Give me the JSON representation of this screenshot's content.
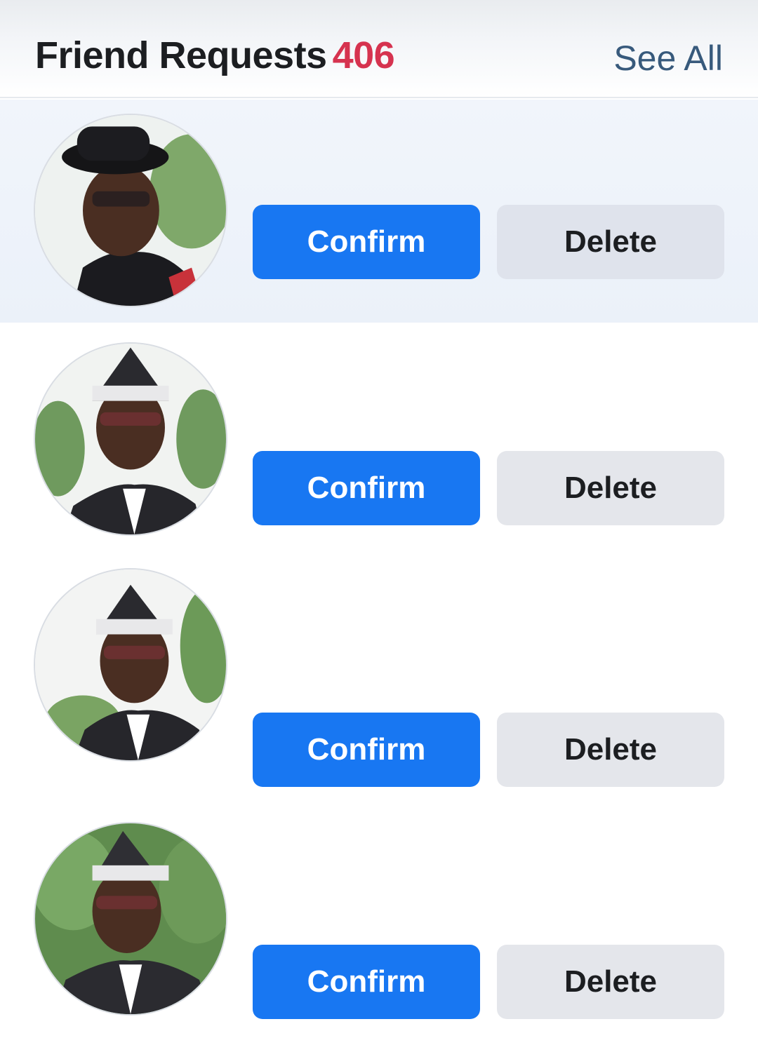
{
  "header": {
    "title": "Friend Requests",
    "count": "406",
    "see_all": "See All"
  },
  "requests": [
    {
      "confirm_label": "Confirm",
      "delete_label": "Delete",
      "highlighted": true
    },
    {
      "confirm_label": "Confirm",
      "delete_label": "Delete",
      "highlighted": false
    },
    {
      "confirm_label": "Confirm",
      "delete_label": "Delete",
      "highlighted": false
    },
    {
      "confirm_label": "Confirm",
      "delete_label": "Delete",
      "highlighted": false
    }
  ],
  "colors": {
    "confirm_button": "#1877f2",
    "delete_button": "#e4e6eb",
    "count_accent": "#d6334f",
    "see_all_link": "#385a7c"
  }
}
